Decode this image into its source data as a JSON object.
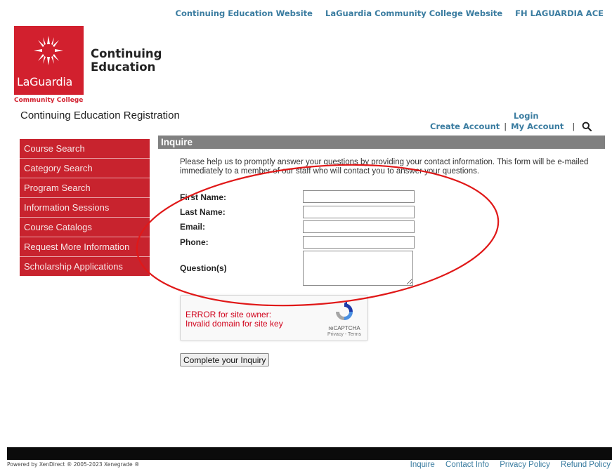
{
  "top_links": [
    "Continuing Education Website",
    "LaGuardia Community College Website",
    "FH LAGUARDIA ACE"
  ],
  "logo": {
    "wordmark": "LaGuardia",
    "name_line1": "Continuing",
    "name_line2": "Education",
    "college": "Community College",
    "brand_color": "#d2202e"
  },
  "site_title": "Continuing Education Registration",
  "account": {
    "login": "Login",
    "create_account": "Create Account",
    "separator": "|",
    "my_account": "My Account",
    "search_icon": "search-icon"
  },
  "sidebar": {
    "items": [
      {
        "label": "Course Search"
      },
      {
        "label": "Category Search"
      },
      {
        "label": "Program Search"
      },
      {
        "label": "Information Sessions"
      },
      {
        "label": "Course Catalogs"
      },
      {
        "label": "Request More Information"
      },
      {
        "label": "Scholarship Applications"
      }
    ]
  },
  "main": {
    "heading": "Inquire",
    "intro": "Please help us to promptly answer your questions by providing your contact information. This form will be e-mailed immediately to a member of our staff who will contact you to answer your questions.",
    "fields": {
      "first_name": {
        "label": "First Name:",
        "value": ""
      },
      "last_name": {
        "label": "Last Name:",
        "value": ""
      },
      "email": {
        "label": "Email:",
        "value": ""
      },
      "phone": {
        "label": "Phone:",
        "value": ""
      },
      "questions": {
        "label": "Question(s)",
        "value": ""
      }
    },
    "captcha": {
      "error_line1": "ERROR for site owner:",
      "error_line2": "Invalid domain for site key",
      "brand": "reCAPTCHA",
      "terms": "Privacy - Terms"
    },
    "submit_label": "Complete your Inquiry"
  },
  "footer": {
    "powered": "Powered by XenDirect ® 2005-2023 Xenegrade ®",
    "links": [
      "Inquire",
      "Contact Info",
      "Privacy Policy",
      "Refund Policy"
    ]
  }
}
